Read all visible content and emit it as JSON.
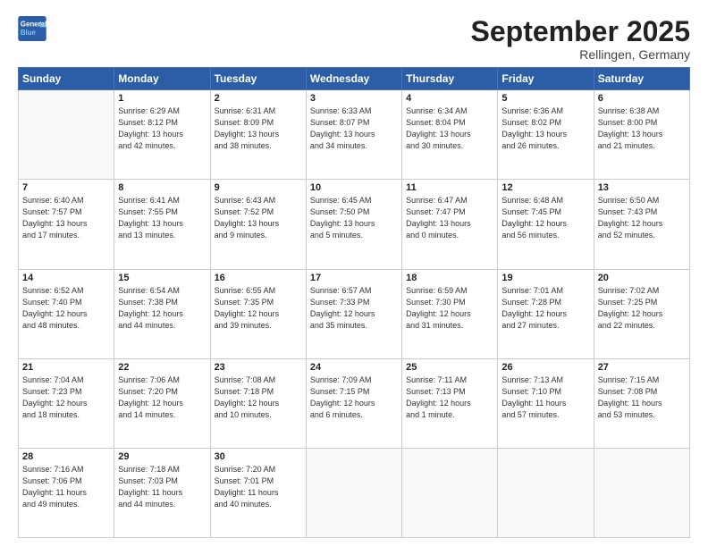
{
  "header": {
    "logo_line1": "General",
    "logo_line2": "Blue",
    "month": "September 2025",
    "location": "Rellingen, Germany"
  },
  "weekdays": [
    "Sunday",
    "Monday",
    "Tuesday",
    "Wednesday",
    "Thursday",
    "Friday",
    "Saturday"
  ],
  "weeks": [
    [
      {
        "day": "",
        "info": ""
      },
      {
        "day": "1",
        "info": "Sunrise: 6:29 AM\nSunset: 8:12 PM\nDaylight: 13 hours\nand 42 minutes."
      },
      {
        "day": "2",
        "info": "Sunrise: 6:31 AM\nSunset: 8:09 PM\nDaylight: 13 hours\nand 38 minutes."
      },
      {
        "day": "3",
        "info": "Sunrise: 6:33 AM\nSunset: 8:07 PM\nDaylight: 13 hours\nand 34 minutes."
      },
      {
        "day": "4",
        "info": "Sunrise: 6:34 AM\nSunset: 8:04 PM\nDaylight: 13 hours\nand 30 minutes."
      },
      {
        "day": "5",
        "info": "Sunrise: 6:36 AM\nSunset: 8:02 PM\nDaylight: 13 hours\nand 26 minutes."
      },
      {
        "day": "6",
        "info": "Sunrise: 6:38 AM\nSunset: 8:00 PM\nDaylight: 13 hours\nand 21 minutes."
      }
    ],
    [
      {
        "day": "7",
        "info": "Sunrise: 6:40 AM\nSunset: 7:57 PM\nDaylight: 13 hours\nand 17 minutes."
      },
      {
        "day": "8",
        "info": "Sunrise: 6:41 AM\nSunset: 7:55 PM\nDaylight: 13 hours\nand 13 minutes."
      },
      {
        "day": "9",
        "info": "Sunrise: 6:43 AM\nSunset: 7:52 PM\nDaylight: 13 hours\nand 9 minutes."
      },
      {
        "day": "10",
        "info": "Sunrise: 6:45 AM\nSunset: 7:50 PM\nDaylight: 13 hours\nand 5 minutes."
      },
      {
        "day": "11",
        "info": "Sunrise: 6:47 AM\nSunset: 7:47 PM\nDaylight: 13 hours\nand 0 minutes."
      },
      {
        "day": "12",
        "info": "Sunrise: 6:48 AM\nSunset: 7:45 PM\nDaylight: 12 hours\nand 56 minutes."
      },
      {
        "day": "13",
        "info": "Sunrise: 6:50 AM\nSunset: 7:43 PM\nDaylight: 12 hours\nand 52 minutes."
      }
    ],
    [
      {
        "day": "14",
        "info": "Sunrise: 6:52 AM\nSunset: 7:40 PM\nDaylight: 12 hours\nand 48 minutes."
      },
      {
        "day": "15",
        "info": "Sunrise: 6:54 AM\nSunset: 7:38 PM\nDaylight: 12 hours\nand 44 minutes."
      },
      {
        "day": "16",
        "info": "Sunrise: 6:55 AM\nSunset: 7:35 PM\nDaylight: 12 hours\nand 39 minutes."
      },
      {
        "day": "17",
        "info": "Sunrise: 6:57 AM\nSunset: 7:33 PM\nDaylight: 12 hours\nand 35 minutes."
      },
      {
        "day": "18",
        "info": "Sunrise: 6:59 AM\nSunset: 7:30 PM\nDaylight: 12 hours\nand 31 minutes."
      },
      {
        "day": "19",
        "info": "Sunrise: 7:01 AM\nSunset: 7:28 PM\nDaylight: 12 hours\nand 27 minutes."
      },
      {
        "day": "20",
        "info": "Sunrise: 7:02 AM\nSunset: 7:25 PM\nDaylight: 12 hours\nand 22 minutes."
      }
    ],
    [
      {
        "day": "21",
        "info": "Sunrise: 7:04 AM\nSunset: 7:23 PM\nDaylight: 12 hours\nand 18 minutes."
      },
      {
        "day": "22",
        "info": "Sunrise: 7:06 AM\nSunset: 7:20 PM\nDaylight: 12 hours\nand 14 minutes."
      },
      {
        "day": "23",
        "info": "Sunrise: 7:08 AM\nSunset: 7:18 PM\nDaylight: 12 hours\nand 10 minutes."
      },
      {
        "day": "24",
        "info": "Sunrise: 7:09 AM\nSunset: 7:15 PM\nDaylight: 12 hours\nand 6 minutes."
      },
      {
        "day": "25",
        "info": "Sunrise: 7:11 AM\nSunset: 7:13 PM\nDaylight: 12 hours\nand 1 minute."
      },
      {
        "day": "26",
        "info": "Sunrise: 7:13 AM\nSunset: 7:10 PM\nDaylight: 11 hours\nand 57 minutes."
      },
      {
        "day": "27",
        "info": "Sunrise: 7:15 AM\nSunset: 7:08 PM\nDaylight: 11 hours\nand 53 minutes."
      }
    ],
    [
      {
        "day": "28",
        "info": "Sunrise: 7:16 AM\nSunset: 7:06 PM\nDaylight: 11 hours\nand 49 minutes."
      },
      {
        "day": "29",
        "info": "Sunrise: 7:18 AM\nSunset: 7:03 PM\nDaylight: 11 hours\nand 44 minutes."
      },
      {
        "day": "30",
        "info": "Sunrise: 7:20 AM\nSunset: 7:01 PM\nDaylight: 11 hours\nand 40 minutes."
      },
      {
        "day": "",
        "info": ""
      },
      {
        "day": "",
        "info": ""
      },
      {
        "day": "",
        "info": ""
      },
      {
        "day": "",
        "info": ""
      }
    ]
  ]
}
